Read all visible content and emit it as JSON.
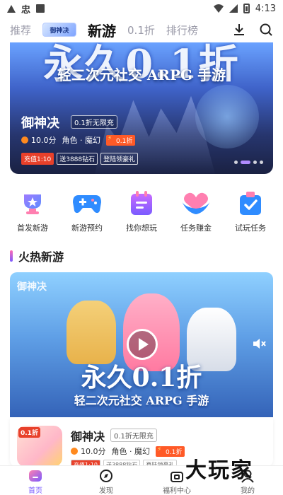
{
  "status_bar": {
    "time": "4:13",
    "app_glyph": "忠"
  },
  "top_nav": {
    "tabs": [
      {
        "label": "推荐"
      },
      {
        "label": "新游"
      },
      {
        "label": "0.1折"
      },
      {
        "label": "排行榜"
      }
    ],
    "active_tab": "新游",
    "logo_text": "御神决",
    "download_icon": "download-icon",
    "search_icon": "search-icon"
  },
  "hero_banner": {
    "headline": "永久0.1折",
    "subheadline": "轻二次元社交 ARPG 手游",
    "game_title": "御神决",
    "badge": "0.1折无限充",
    "score": "10.0分",
    "genre": "角色 · 魔幻",
    "discount": "0.1折",
    "tags": [
      "充值1:10",
      "送3888钻石",
      "登陆领豪礼"
    ],
    "page_dots": 4,
    "active_dot": 2
  },
  "quick_entries": [
    {
      "label": "首发新游",
      "icon": "trophy-icon",
      "color": "#7a5bff"
    },
    {
      "label": "新游预约",
      "icon": "gamepad-icon",
      "color": "#2f8cff"
    },
    {
      "label": "找你想玩",
      "icon": "list-icon",
      "color": "#b24bff"
    },
    {
      "label": "任务赚金",
      "icon": "heart-hands-icon",
      "color": "#2f8cff"
    },
    {
      "label": "试玩任务",
      "icon": "check-icon",
      "color": "#2f8cff"
    }
  ],
  "section": {
    "title": "火热新游"
  },
  "featured_video": {
    "logo_text": "御神决",
    "headline": "永久0.1折",
    "subheadline": "轻二次元社交 ARPG 手游"
  },
  "game_card": {
    "icon_badge": "0.1折",
    "title": "御神决",
    "badge": "0.1折无限充",
    "score": "10.0分",
    "genre": "角色 · 魔幻",
    "discount": "0.1折",
    "tags": [
      "充值1:10",
      "送3888钻石",
      "登陆领豪礼"
    ]
  },
  "watermark": "大玩家",
  "bottom_nav": [
    {
      "label": "首页",
      "icon": "home-icon",
      "active": true
    },
    {
      "label": "发现",
      "icon": "compass-icon",
      "active": false
    },
    {
      "label": "福利中心",
      "icon": "gift-icon",
      "active": false
    },
    {
      "label": "我的",
      "icon": "user-icon",
      "active": false
    }
  ],
  "colors": {
    "accent": "#7a5bff",
    "discount": "#ff5a27",
    "score": "#ff8a1f"
  }
}
